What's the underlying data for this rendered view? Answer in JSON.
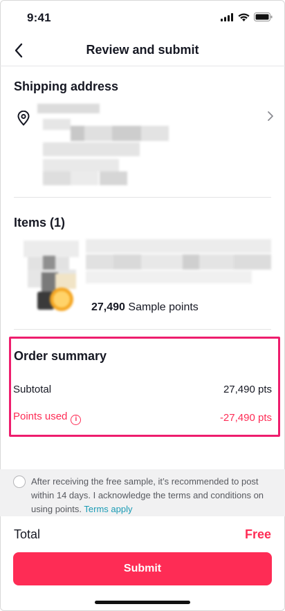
{
  "status_bar": {
    "time": "9:41"
  },
  "nav": {
    "title": "Review and submit"
  },
  "shipping": {
    "title": "Shipping address"
  },
  "items": {
    "title": "Items (1)",
    "points_value": "27,490",
    "points_unit": "Sample points"
  },
  "order_summary": {
    "title": "Order summary",
    "subtotal_label": "Subtotal",
    "subtotal_value": "27,490 pts",
    "points_used_label": "Points used",
    "points_used_value": "-27,490 pts"
  },
  "notice": {
    "text": "After receiving the free sample, it’s recommended to post within 14 days. I acknowledge the terms and conditions on using points.",
    "link": "Terms apply"
  },
  "footer": {
    "total_label": "Total",
    "total_value": "Free",
    "submit_label": "Submit"
  },
  "colors": {
    "accent": "#fe2c55",
    "highlight": "#ee1d6d",
    "link": "#1a9bb5"
  },
  "icons": [
    "back-arrow-icon",
    "location-pin-icon",
    "chevron-right-icon",
    "info-icon",
    "signal-icon",
    "wifi-icon",
    "battery-icon"
  ]
}
